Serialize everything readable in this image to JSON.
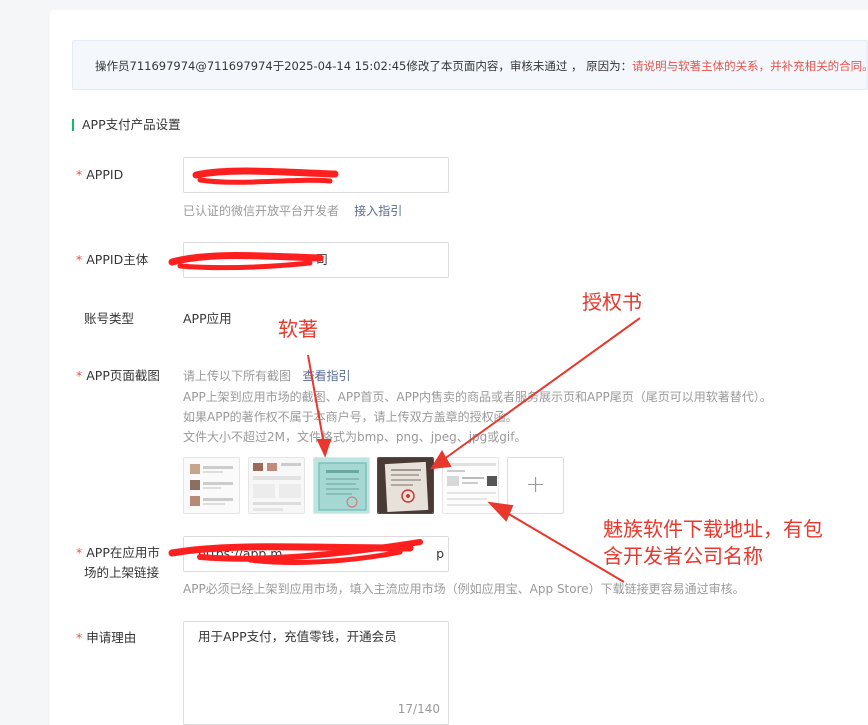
{
  "notice": {
    "prefix": "操作员711697974@711697974于2025-04-14 15:02:45修改了本页面内容，审核未通过 ， 原因为：",
    "reason": "请说明与软著主体的关系，并补充相关的合同。"
  },
  "section": {
    "title": "APP支付产品设置"
  },
  "appid": {
    "label": "APPID",
    "value": "",
    "hint": "已认证的微信开放平台开发者",
    "hint_link": "接入指引"
  },
  "appid_subject": {
    "label": "APPID主体",
    "value": "司"
  },
  "account_type": {
    "label": "账号类型",
    "value": "APP应用"
  },
  "screenshots": {
    "label": "APP页面截图",
    "hint_line1": "请上传以下所有截图",
    "hint_link": "查看指引",
    "hint_line2": "APP上架到应用市场的截图、APP首页、APP内售卖的商品或者服务展示页和APP尾页（尾页可以用软著替代）。",
    "hint_line3": "如果APP的著作权不属于本商户号，请上传双方盖章的授权函。",
    "hint_line4": "文件大小不超过2M，文件格式为bmp、png、jpeg、jpg或gif。",
    "thumbnails": [
      "app-screenshot-1",
      "app-screenshot-2",
      "software-copyright-certificate",
      "authorization-letter",
      "download-page-screenshot"
    ],
    "add_symbol": "+"
  },
  "market_link": {
    "label_line1": "APP在应用市",
    "label_line2": "场的上架链接",
    "value": "https://app.m...",
    "value_suffix": "p",
    "hint": "APP必须已经上架到应用市场，填入主流应用市场（例如应用宝、App Store）下载链接更容易通过审核。"
  },
  "reason": {
    "label": "申请理由",
    "value": "用于APP支付，充值零钱，开通会员",
    "counter": "17/140"
  },
  "annotations": {
    "copyright": "软著",
    "authorization": "授权书",
    "meizu_line1": "魅族软件下载地址，有包",
    "meizu_line2": "含开发者公司名称"
  },
  "colors": {
    "accent": "#07c160",
    "link": "#576b95",
    "error": "#e5534b",
    "annotation": "#e8372c"
  }
}
